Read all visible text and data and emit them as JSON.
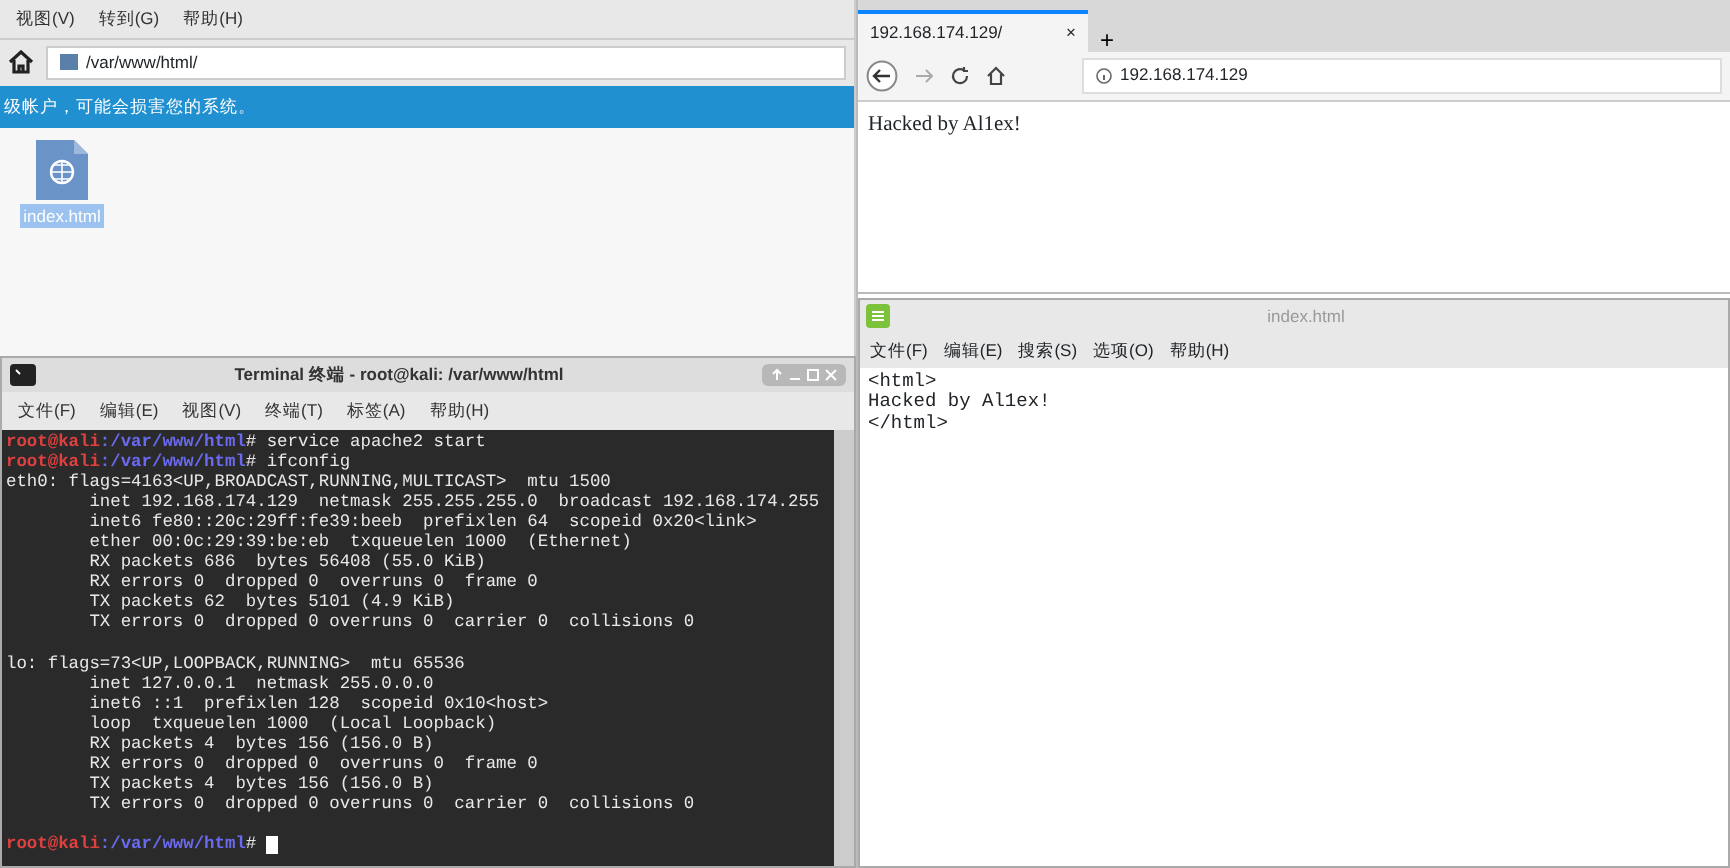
{
  "file_manager": {
    "menu": [
      "视图(V)",
      "转到(G)",
      "帮助(H)"
    ],
    "location": "/var/www/html/",
    "banner": "级帐户，可能会损害您的系统。",
    "files": [
      {
        "name": "index.html",
        "selected": true
      }
    ]
  },
  "terminal": {
    "title": "Terminal 终端 - root@kali: /var/www/html",
    "menu": [
      "文件(F)",
      "编辑(E)",
      "视图(V)",
      "终端(T)",
      "标签(A)",
      "帮助(H)"
    ],
    "lines": [
      {
        "kind": "prompt",
        "user": "root@kali",
        "path": ":/var/www/html",
        "command": "# service apache2 start",
        "cursor": false
      },
      {
        "kind": "prompt",
        "user": "root@kali",
        "path": ":/var/www/html",
        "command": "# ifconfig",
        "cursor": false
      },
      {
        "kind": "output",
        "text": "eth0: flags=4163<UP,BROADCAST,RUNNING,MULTICAST>  mtu 1500"
      },
      {
        "kind": "output",
        "text": "        inet 192.168.174.129  netmask 255.255.255.0  broadcast 192.168.174.255"
      },
      {
        "kind": "output",
        "text": "        inet6 fe80::20c:29ff:fe39:beeb  prefixlen 64  scopeid 0x20<link>"
      },
      {
        "kind": "output",
        "text": "        ether 00:0c:29:39:be:eb  txqueuelen 1000  (Ethernet)"
      },
      {
        "kind": "output",
        "text": "        RX packets 686  bytes 56408 (55.0 KiB)"
      },
      {
        "kind": "output",
        "text": "        RX errors 0  dropped 0  overruns 0  frame 0"
      },
      {
        "kind": "output",
        "text": "        TX packets 62  bytes 5101 (4.9 KiB)"
      },
      {
        "kind": "output",
        "text": "        TX errors 0  dropped 0 overruns 0  carrier 0  collisions 0"
      },
      {
        "kind": "blank"
      },
      {
        "kind": "output",
        "text": "lo: flags=73<UP,LOOPBACK,RUNNING>  mtu 65536"
      },
      {
        "kind": "output",
        "text": "        inet 127.0.0.1  netmask 255.0.0.0"
      },
      {
        "kind": "output",
        "text": "        inet6 ::1  prefixlen 128  scopeid 0x10<host>"
      },
      {
        "kind": "output",
        "text": "        loop  txqueuelen 1000  (Local Loopback)"
      },
      {
        "kind": "output",
        "text": "        RX packets 4  bytes 156 (156.0 B)"
      },
      {
        "kind": "output",
        "text": "        RX errors 0  dropped 0  overruns 0  frame 0"
      },
      {
        "kind": "output",
        "text": "        TX packets 4  bytes 156 (156.0 B)"
      },
      {
        "kind": "output",
        "text": "        TX errors 0  dropped 0 overruns 0  carrier 0  collisions 0"
      },
      {
        "kind": "blank"
      },
      {
        "kind": "prompt",
        "user": "root@kali",
        "path": ":/var/www/html",
        "command": "#",
        "cursor": true
      }
    ]
  },
  "browser": {
    "tabs": [
      {
        "label": "192.168.174.129/",
        "close": "×",
        "selected": true
      }
    ],
    "new_tab": "+",
    "address": "192.168.174.129",
    "content": "Hacked by Al1ex!"
  },
  "editor": {
    "title": "index.html",
    "menu": [
      "文件(F)",
      "编辑(E)",
      "搜索(S)",
      "选项(O)",
      "帮助(H)"
    ],
    "lines": [
      "<html>",
      "Hacked by Al1ex!",
      "</html>"
    ]
  }
}
